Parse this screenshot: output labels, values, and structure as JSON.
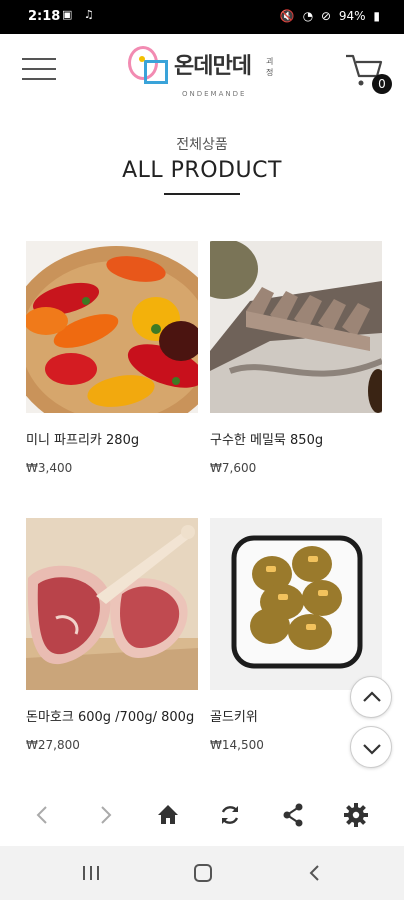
{
  "status": {
    "time": "2:18",
    "battery": "94%"
  },
  "header": {
    "logo_text": "온데만데",
    "logo_sub": "ONDEMANDE",
    "logo_chip": "괴정",
    "cart_count": "0"
  },
  "section": {
    "title_kr": "전체상품",
    "title_en": "ALL PRODUCT"
  },
  "products": [
    {
      "name": "미니 파프리카 280g",
      "price": "₩3,400"
    },
    {
      "name": "구수한 메밀묵 850g",
      "price": "₩7,600"
    },
    {
      "name": "돈마호크 600g /700g/ 800g",
      "price": "₩27,800"
    },
    {
      "name": "골드키위",
      "price": "₩14,500"
    }
  ],
  "icons": {
    "menu": "hamburger-menu-icon",
    "cart": "cart-icon",
    "scroll_up": "chevron-up-icon",
    "scroll_down": "chevron-down-icon",
    "back": "arrow-left-icon",
    "forward": "arrow-right-icon",
    "home": "home-icon",
    "refresh": "refresh-icon",
    "share": "share-icon",
    "settings": "gear-icon"
  },
  "colors": {
    "accent_pink": "#f28bb2",
    "accent_blue": "#3aa3d9",
    "accent_yellow": "#f3c000"
  }
}
